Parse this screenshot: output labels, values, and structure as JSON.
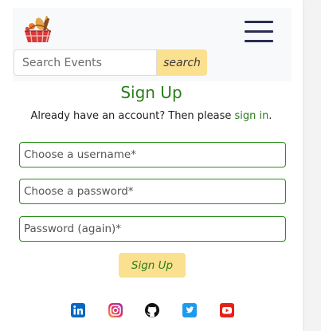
{
  "header": {
    "logo_icon": "picnic-basket-logo-icon",
    "menu_icon": "hamburger-menu-icon"
  },
  "search": {
    "placeholder": "Search Events",
    "button_label": "search"
  },
  "signup": {
    "title": "Sign Up",
    "prompt_text": "Already have an account? Then please ",
    "signin_link": "sign in",
    "prompt_end": ".",
    "username_placeholder": "Choose a username*",
    "password_placeholder": "Choose a password*",
    "password_again_placeholder": "Password (again)*",
    "submit_label": "Sign Up"
  },
  "footer": {
    "social_icons": [
      "linkedin-icon",
      "instagram-icon",
      "github-icon",
      "twitter-icon",
      "youtube-icon"
    ]
  },
  "colors": {
    "accent_green": "#2a7d19",
    "button_yellow": "#fbe08f",
    "hamburger": "#2b2d52",
    "header_bg": "#f8f9fa"
  }
}
